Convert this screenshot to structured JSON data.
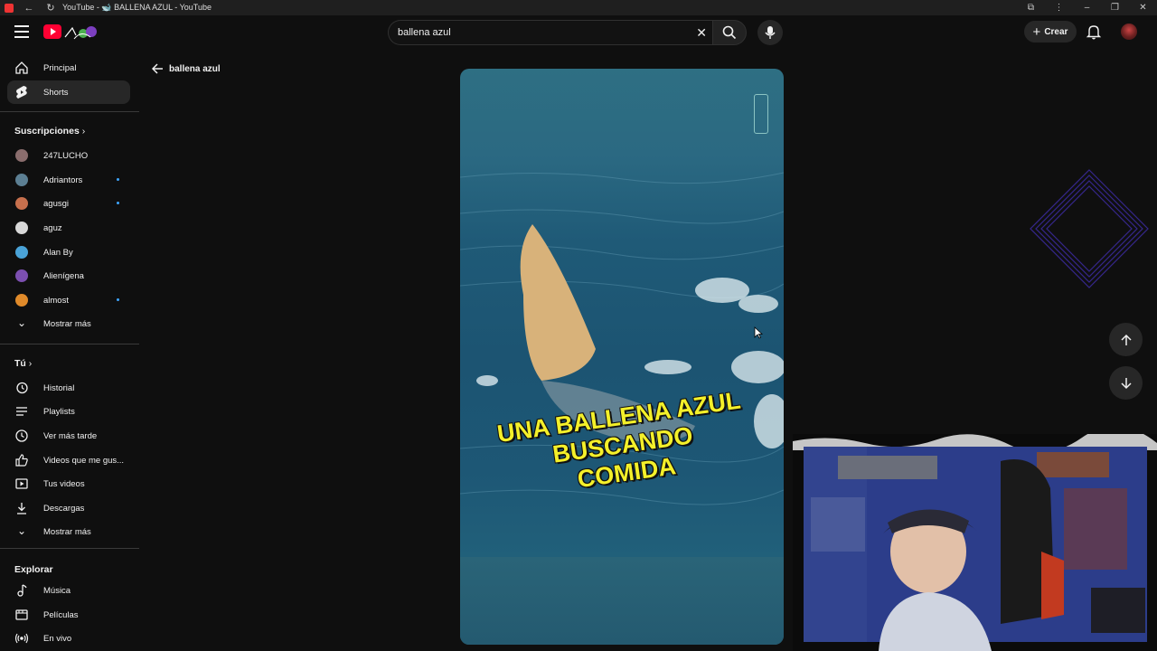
{
  "browser": {
    "tab_title": "YouTube - 🐋 BALLENA AZUL - YouTube"
  },
  "header": {
    "search_value": "ballena azul",
    "create_label": "Crear"
  },
  "sidebar": {
    "main": [
      {
        "label": "Principal",
        "icon": "home-icon"
      },
      {
        "label": "Shorts",
        "icon": "shorts-icon"
      }
    ],
    "subscriptions_title": "Suscripciones",
    "subscriptions": [
      {
        "label": "247LUCHO",
        "color": "#8a6d6d",
        "new": false
      },
      {
        "label": "Adriantors",
        "color": "#5c7f93",
        "new": true
      },
      {
        "label": "agusgi",
        "color": "#c7704d",
        "new": true
      },
      {
        "label": "aguz",
        "color": "#d8d8d8",
        "new": false
      },
      {
        "label": "Alan By",
        "color": "#4aa3d8",
        "new": false
      },
      {
        "label": "Alienígena",
        "color": "#7c4fb0",
        "new": false
      },
      {
        "label": "almost",
        "color": "#e08a2a",
        "new": true
      }
    ],
    "show_more_1": "Mostrar más",
    "you_title": "Tú",
    "you": [
      {
        "label": "Historial",
        "icon": "history-icon"
      },
      {
        "label": "Playlists",
        "icon": "playlist-icon"
      },
      {
        "label": "Ver más tarde",
        "icon": "watch-later-icon"
      },
      {
        "label": "Videos que me gus...",
        "icon": "like-icon"
      },
      {
        "label": "Tus videos",
        "icon": "your-videos-icon"
      },
      {
        "label": "Descargas",
        "icon": "download-icon"
      }
    ],
    "show_more_2": "Mostrar más",
    "explore_title": "Explorar",
    "explore": [
      {
        "label": "Música",
        "icon": "music-icon"
      },
      {
        "label": "Películas",
        "icon": "movies-icon"
      },
      {
        "label": "En vivo",
        "icon": "live-icon"
      }
    ]
  },
  "content": {
    "back_label": "ballena azul",
    "caption_line1": "UNA BALLENA AZUL BUSCANDO",
    "caption_line2": "COMIDA"
  },
  "colors": {
    "background": "#0f0f0f",
    "caption": "#f4f02a",
    "accent_red": "#ff0033",
    "diamond": "#3a2a9a"
  }
}
